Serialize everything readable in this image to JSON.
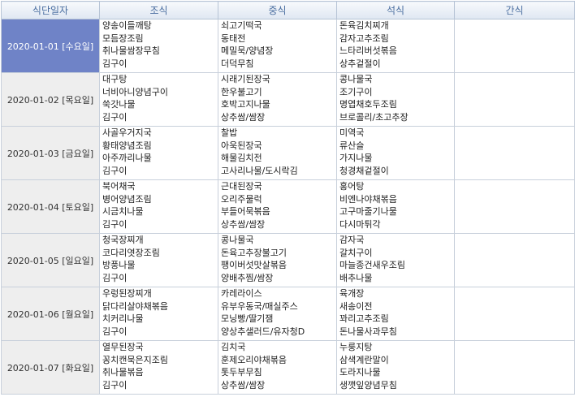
{
  "columns": [
    "식단일자",
    "조식",
    "중식",
    "석식",
    "간식"
  ],
  "rows": [
    {
      "date": "2020-01-01 [수요일]",
      "selected": true,
      "breakfast": [
        "양송이들깨탕",
        "모듬장조림",
        "취나물쌈장무침",
        "김구이"
      ],
      "lunch": [
        "쇠고기떡국",
        "동태전",
        "메밀묵/양념장",
        "더덕무침"
      ],
      "dinner": [
        "돈육김치찌개",
        "감자고추조림",
        "느타리버섯볶음",
        "상추겉절이"
      ],
      "snack": []
    },
    {
      "date": "2020-01-02 [목요일]",
      "selected": false,
      "breakfast": [
        "대구탕",
        "너비아니양념구이",
        "쑥갓나물",
        "김구이"
      ],
      "lunch": [
        "시래기된장국",
        "한우불고기",
        "호박고지나물",
        "상추쌈/쌈장"
      ],
      "dinner": [
        "콩나물국",
        "조기구이",
        "명엽채호두조림",
        "브로콜리/초고추장"
      ],
      "snack": []
    },
    {
      "date": "2020-01-03 [금요일]",
      "selected": false,
      "breakfast": [
        "사골우거지국",
        "황태양념조림",
        "아주까리나물",
        "김구이"
      ],
      "lunch": [
        "찰밥",
        "아욱된장국",
        "해물김치전",
        "고사리나물/도시락김"
      ],
      "dinner": [
        "미역국",
        "류산슬",
        "가지나물",
        "청경채겉절이"
      ],
      "snack": []
    },
    {
      "date": "2020-01-04 [토요일]",
      "selected": false,
      "breakfast": [
        "북어채국",
        "병어양념조림",
        "시금치나물",
        "김구이"
      ],
      "lunch": [
        "근대된장국",
        "오리주물럭",
        "부들어묵볶음",
        "상추쌈/쌈장"
      ],
      "dinner": [
        "홍어탕",
        "비엔나야채볶음",
        "고구마줄기나물",
        "다시마튀각"
      ],
      "snack": []
    },
    {
      "date": "2020-01-05 [일요일]",
      "selected": false,
      "breakfast": [
        "청국장찌개",
        "코다리엿장조림",
        "방풍나물",
        "김구이"
      ],
      "lunch": [
        "콩나물국",
        "돈육고추장불고기",
        "팽이버섯맛살볶음",
        "양배추찜/쌈장"
      ],
      "dinner": [
        "감자국",
        "갈치구이",
        "마늘종건새우조림",
        "배추나물"
      ],
      "snack": []
    },
    {
      "date": "2020-01-06 [월요일]",
      "selected": false,
      "breakfast": [
        "우렁된장찌개",
        "닭다리살야채볶음",
        "치커리나물",
        "김구이"
      ],
      "lunch": [
        "카레라이스",
        "유부우동국/매실주스",
        "모닝빵/딸기잼",
        "양상추샐러드/유자청D"
      ],
      "dinner": [
        "육개장",
        "새송이전",
        "꽈리고추조림",
        "돈나물사과무침"
      ],
      "snack": []
    },
    {
      "date": "2020-01-07 [화요일]",
      "selected": false,
      "breakfast": [
        "열무된장국",
        "꽁치캔묵은지조림",
        "취나물볶음",
        "김구이"
      ],
      "lunch": [
        "김치국",
        "훈제오리야채볶음",
        "톳두부무침",
        "상추쌈/쌈장"
      ],
      "dinner": [
        "누룽지탕",
        "삼색계란말이",
        "도라지나물",
        "생깻잎양념무침"
      ],
      "snack": []
    }
  ]
}
